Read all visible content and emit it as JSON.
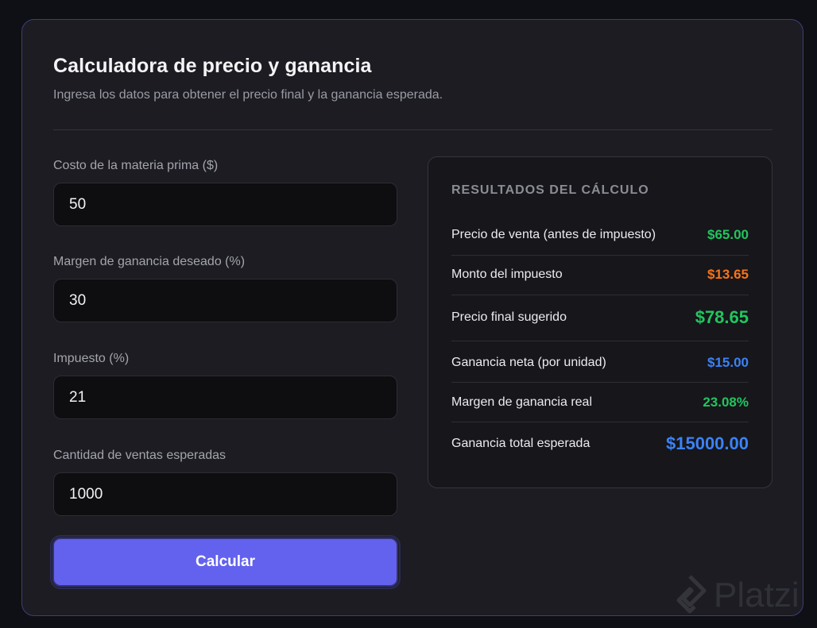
{
  "header": {
    "title": "Calculadora de precio y ganancia",
    "subtitle": "Ingresa los datos para obtener el precio final y la ganancia esperada."
  },
  "form": {
    "fields": [
      {
        "label": "Costo de la materia prima ($)",
        "value": "50"
      },
      {
        "label": "Margen de ganancia deseado (%)",
        "value": "30"
      },
      {
        "label": "Impuesto (%)",
        "value": "21"
      },
      {
        "label": "Cantidad de ventas esperadas",
        "value": "1000"
      }
    ],
    "button_label": "Calcular"
  },
  "results": {
    "heading": "RESULTADOS DEL CÁLCULO",
    "rows": [
      {
        "label": "Precio de venta (antes de impuesto)",
        "value": "$65.00",
        "color": "#22c55e"
      },
      {
        "label": "Monto del impuesto",
        "value": "$13.65",
        "color": "#f97316"
      },
      {
        "label": "Precio final sugerido",
        "value": "$78.65",
        "color": "#22c55e"
      },
      {
        "label": "Ganancia neta (por unidad)",
        "value": "$15.00",
        "color": "#3b82f6"
      },
      {
        "label": "Margen de ganancia real",
        "value": "23.08%",
        "color": "#22c55e"
      },
      {
        "label": "Ganancia total esperada",
        "value": "$15000.00",
        "color": "#3b82f6"
      }
    ]
  },
  "watermark": {
    "text": "Platzi",
    "icon": "platzi-logo-icon"
  }
}
